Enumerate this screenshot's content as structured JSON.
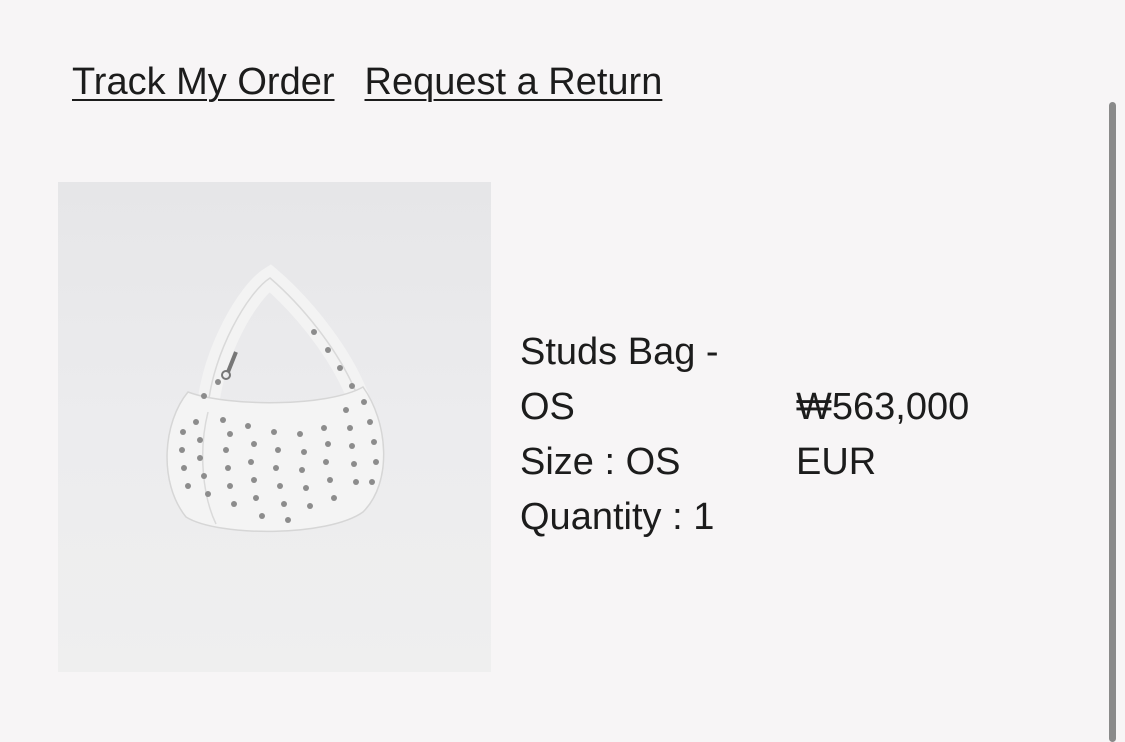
{
  "links": {
    "track_order": "Track My Order",
    "request_return": "Request a Return"
  },
  "product": {
    "name_line1": "Studs Bag -",
    "name_line2": "OS",
    "size": "Size : OS",
    "quantity": "Quantity : 1",
    "price": "₩563,000",
    "currency": "EUR"
  },
  "colors": {
    "background": "#f7f5f6",
    "text": "#1c1c1c",
    "image_bg": "#e9e9eb",
    "scrollbar": "#8a8a8a"
  }
}
